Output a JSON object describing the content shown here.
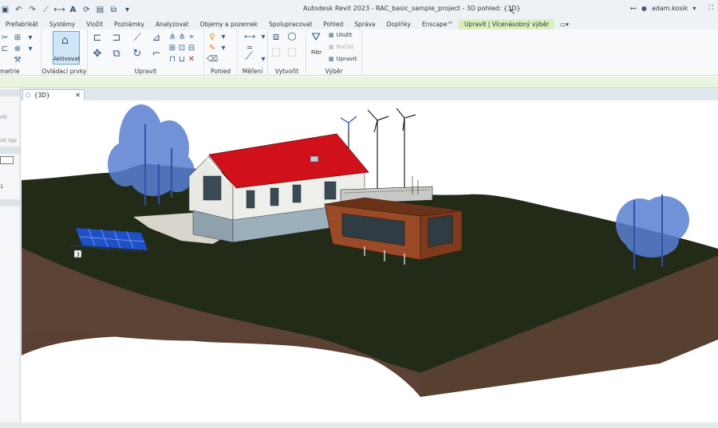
{
  "window": {
    "title": "Autodesk Revit 2023 - RAC_basic_sample_project - 3D pohled: {3D}",
    "user": "adam.kosik"
  },
  "quick_access": [
    "save-icon",
    "undo-icon",
    "redo-icon",
    "measure-icon",
    "text-icon",
    "sync-icon",
    "view-icon"
  ],
  "ribbon_tabs": [
    {
      "label": "Prefabrikát"
    },
    {
      "label": "Systémy"
    },
    {
      "label": "Vložit"
    },
    {
      "label": "Poznámky"
    },
    {
      "label": "Analyzovat"
    },
    {
      "label": "Objemy a pozemek"
    },
    {
      "label": "Spolupracovat"
    },
    {
      "label": "Pohled"
    },
    {
      "label": "Správa"
    },
    {
      "label": "Doplňky"
    },
    {
      "label": "Enscape™"
    },
    {
      "label": "Upravit | Vícenásobný výběr",
      "active": true
    }
  ],
  "panels": {
    "geometry": "metrie",
    "controls": "Ovládací prvky",
    "activate": "Aktivovat",
    "modify": "Upravit",
    "view": "Pohled",
    "measure": "Měření",
    "create": "Vytvořit",
    "selection": "Výběr",
    "filter": "Filtr",
    "save": "Uložit",
    "load": "Načíst",
    "edit": "Upravit"
  },
  "view_tab": {
    "label": "{3D}"
  },
  "left_panel": {
    "items": [
      "riti",
      "vit typ",
      "1"
    ]
  },
  "scene": {
    "label": "3",
    "colors": {
      "terrain_top": "#222a18",
      "terrain_side": "#5a4032",
      "roof": "#d0101a",
      "cladding": "#9a4a26",
      "trees": "#5a7fd2"
    }
  }
}
